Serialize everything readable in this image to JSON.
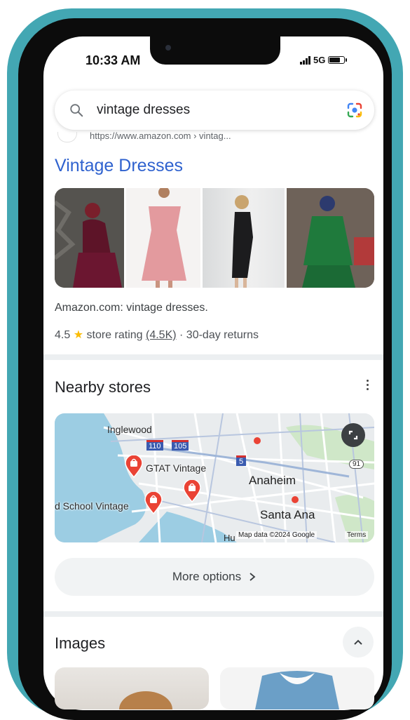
{
  "status_bar": {
    "time": "10:33 AM",
    "network": "5G",
    "battery_level": 0.8
  },
  "search": {
    "query": "vintage dresses"
  },
  "result": {
    "url": "https://www.amazon.com › vintag...",
    "title": "Vintage Dresses",
    "source_text": "Amazon.com: vintage dresses.",
    "rating_value": "4.5",
    "rating_star": "★",
    "rating_label": "store rating",
    "rating_count": "(4.5K)",
    "returns": "· 30-day returns"
  },
  "nearby": {
    "heading": "Nearby stores",
    "map": {
      "labels": {
        "inglewood": "Inglewood",
        "gtat": "GTAT Vintage",
        "anaheim": "Anaheim",
        "school": "d School Vintage",
        "santa_ana": "Santa Ana",
        "huntington": "Hu",
        "hwy_110": "110",
        "hwy_105": "105",
        "hwy_5": "5",
        "hwy_91": "91"
      },
      "attribution": "Map data ©2024 Google",
      "terms": "Terms"
    },
    "more_options": "More options"
  },
  "images": {
    "heading": "Images"
  },
  "colors": {
    "frame_teal": "#43a7b3",
    "link_blue": "#2f62cf",
    "pin_red": "#ea4335",
    "star": "#fbbc04"
  }
}
